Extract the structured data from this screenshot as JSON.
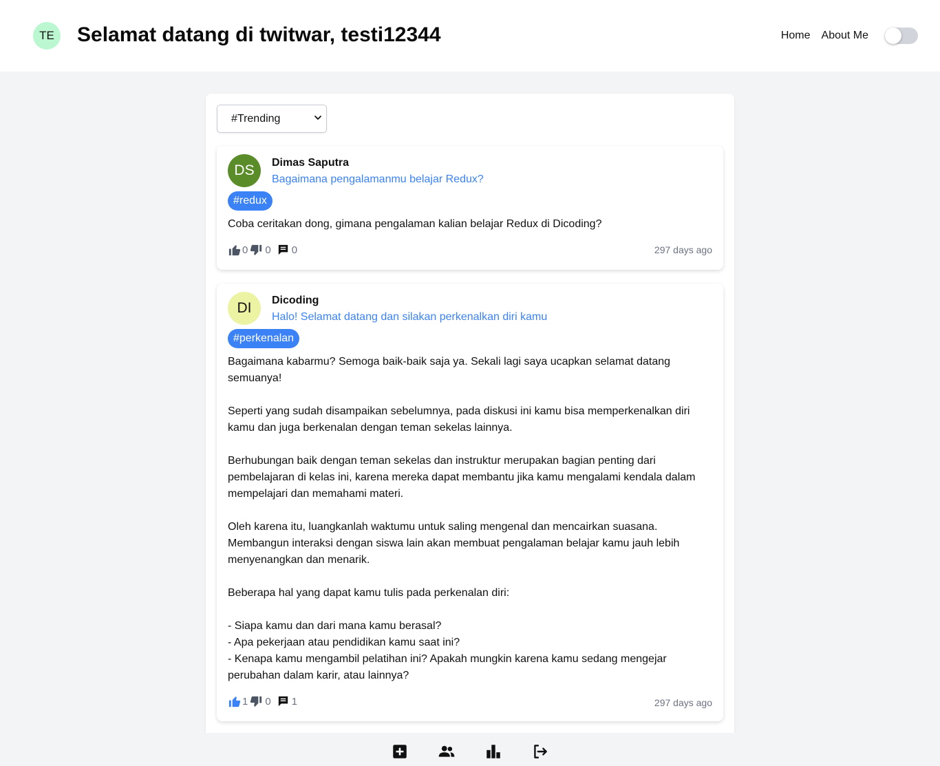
{
  "header": {
    "avatar_initials": "TE",
    "avatar_color": "#bbf7d0",
    "title": "Selamat datang di twitwar, testi12344",
    "nav": [
      {
        "label": "Home"
      },
      {
        "label": "About Me"
      }
    ],
    "theme_toggle": {
      "on": false
    }
  },
  "filter": {
    "selected": "#Trending"
  },
  "threads": [
    {
      "avatar_initials": "DS",
      "avatar_bg": "#5b8c2a",
      "avatar_fg": "#ffffff",
      "owner": "Dimas Saputra",
      "title": "Bagaimana pengalamanmu belajar Redux?",
      "category": "#redux",
      "body": "Coba ceritakan dong, gimana pengalaman kalian belajar Redux di Dicoding?",
      "up_votes": "0",
      "down_votes": "0",
      "comments": "0",
      "liked": false,
      "created": "297 days ago"
    },
    {
      "avatar_initials": "DI",
      "avatar_bg": "#ecf3a2",
      "avatar_fg": "#111111",
      "owner": "Dicoding",
      "title": "Halo! Selamat datang dan silakan perkenalkan diri kamu",
      "category": "#perkenalan",
      "body": "Bagaimana kabarmu? Semoga baik-baik saja ya. Sekali lagi saya ucapkan selamat datang semuanya!\n\nSeperti yang sudah disampaikan sebelumnya, pada diskusi ini kamu bisa memperkenalkan diri kamu dan juga berkenalan dengan teman sekelas lainnya.\n\nBerhubungan baik dengan teman sekelas dan instruktur merupakan bagian penting dari pembelajaran di kelas ini, karena mereka dapat membantu jika kamu mengalami kendala dalam mempelajari dan memahami materi.\n\nOleh karena itu, luangkanlah waktumu untuk saling mengenal dan mencairkan suasana. Membangun interaksi dengan siswa lain akan membuat pengalaman belajar kamu jauh lebih menyenangkan dan menarik.\n\nBeberapa hal yang dapat kamu tulis pada perkenalan diri:\n\n- Siapa kamu dan dari mana kamu berasal?\n- Apa pekerjaan atau pendidikan kamu saat ini?\n- Kenapa kamu mengambil pelatihan ini? Apakah mungkin karena kamu sedang mengejar perubahan dalam karir, atau lainnya?",
      "up_votes": "1",
      "down_votes": "0",
      "comments": "1",
      "liked": true,
      "created": "297 days ago"
    }
  ],
  "bottom_nav": [
    {
      "icon": "add-thread-icon"
    },
    {
      "icon": "users-icon"
    },
    {
      "icon": "leaderboard-icon"
    },
    {
      "icon": "logout-icon"
    }
  ],
  "colors": {
    "accent": "#3b82f6",
    "liked": "#3b82f6",
    "icon_default": "#4b5563"
  }
}
